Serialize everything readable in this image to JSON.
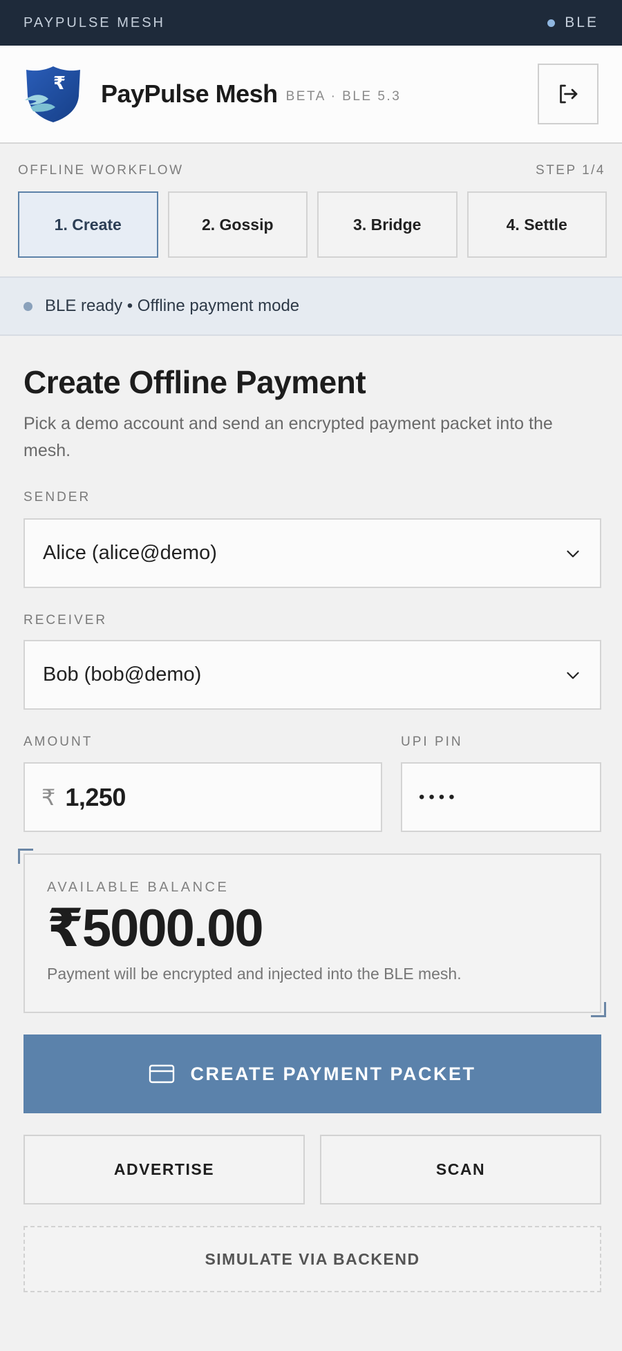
{
  "topbar": {
    "brand": "PAYPULSE MESH",
    "ble_label": "BLE"
  },
  "header": {
    "title": "PayPulse Mesh",
    "subtitle": "BETA · BLE 5.3",
    "logout_icon": "logout-icon"
  },
  "workflow": {
    "label": "OFFLINE WORKFLOW",
    "step_indicator": "STEP 1/4",
    "steps": [
      "1. Create",
      "2. Gossip",
      "3. Bridge",
      "4. Settle"
    ],
    "active_index": 0
  },
  "status": {
    "text": "BLE ready • Offline payment mode"
  },
  "main": {
    "title": "Create Offline Payment",
    "description": "Pick a demo account and send an encrypted payment packet into the mesh."
  },
  "form": {
    "sender_label": "SENDER",
    "sender_value": "Alice (alice@demo)",
    "receiver_label": "RECEIVER",
    "receiver_value": "Bob (bob@demo)",
    "amount_label": "AMOUNT",
    "currency_symbol": "₹",
    "amount_value": "1,250",
    "pin_label": "UPI PIN",
    "pin_value": "••••"
  },
  "balance": {
    "label": "AVAILABLE BALANCE",
    "amount": "₹5000.00",
    "note": "Payment will be encrypted and injected into the BLE mesh."
  },
  "actions": {
    "create_label": "CREATE PAYMENT PACKET",
    "advertise_label": "ADVERTISE",
    "scan_label": "SCAN",
    "simulate_label": "SIMULATE VIA BACKEND"
  },
  "colors": {
    "topbar_bg": "#1e2a3a",
    "accent": "#5b82ab",
    "active_step_bg": "#e7edf5",
    "status_strip_bg": "#e6ebf1"
  }
}
